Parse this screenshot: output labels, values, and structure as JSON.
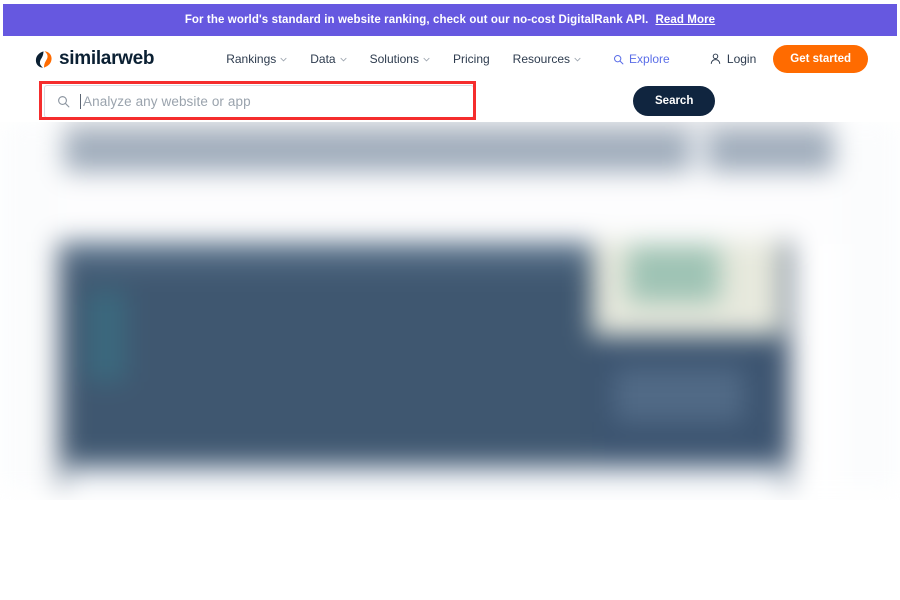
{
  "promo": {
    "text": "For the world's standard in website ranking, check out our no-cost DigitalRank API.",
    "link_label": "Read More",
    "background_color": "#6658e0",
    "text_color": "#ffffff"
  },
  "header": {
    "logo_text": "similarweb",
    "logo_icon": "similarweb-logo-mark",
    "logo_colors": {
      "dark": "#0b2033",
      "accent": "#ff6b00"
    },
    "nav": [
      {
        "label": "Rankings",
        "has_dropdown": true
      },
      {
        "label": "Data",
        "has_dropdown": true
      },
      {
        "label": "Solutions",
        "has_dropdown": true
      },
      {
        "label": "Pricing",
        "has_dropdown": false
      },
      {
        "label": "Resources",
        "has_dropdown": true
      }
    ],
    "explore": {
      "label": "Explore",
      "icon": "search-icon",
      "color": "#5b6ee8"
    },
    "login": {
      "label": "Login",
      "icon": "user-icon"
    },
    "get_started": {
      "label": "Get started",
      "background_color": "#ff6b00"
    }
  },
  "search": {
    "icon": "search-icon",
    "placeholder": "Analyze any website or app",
    "value": "",
    "button_label": "Search",
    "button_color": "#10253f"
  },
  "annotation": {
    "color": "#f52d2d",
    "target": "search-input"
  }
}
